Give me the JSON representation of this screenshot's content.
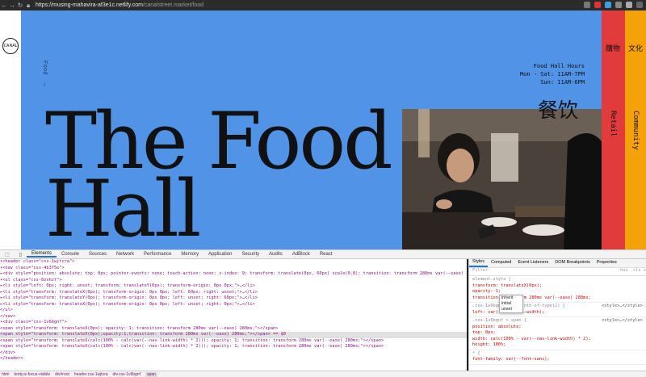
{
  "browser": {
    "url_host": "https://musing-mahavira-af3e1c.netlify.com",
    "url_path": "/canalstreet.market/food"
  },
  "site": {
    "logo_text": "CANAL",
    "food_nav": "Food",
    "hours_title": "Food Hall Hours",
    "hours_line1": "Mon - Sat: 11AM-7PM",
    "hours_line2": "Sun: 11AM-6PM",
    "chinese_title": "餐饮",
    "hero_line1": "The Food",
    "hero_line2": "Hall",
    "retail_ch": "購物",
    "retail": "Retail",
    "community_ch": "文化",
    "community": "Community",
    "colors": {
      "blue": "#5193e6",
      "red": "#e23b3b",
      "orange": "#f5a10a"
    }
  },
  "devtools": {
    "tabs": [
      "Elements",
      "Console",
      "Sources",
      "Network",
      "Performance",
      "Memory",
      "Application",
      "Security",
      "Audits",
      "AdBlock",
      "React"
    ],
    "elements_lines": [
      "▾<header class=\"css-1wjtcra\">",
      "  ▾<nav class=\"css-4b375e\">",
      "    ▸<div style=\"position: absolute; top: 0px; pointer-events: none; touch-action: none; z-index: 9; transform: translate(0px, 60px) scale(0.8); transition: transform 280ms var(--ease) 280ms;\">…</div>",
      "    ▾<ul class=\"css-8zvhzf\">",
      "      ▸<li style=\"left: 0px; right: unset; transform: translateY(0px); transform-origin: 0px 0px;\">…</li>",
      "      ▸<li style=\"transform: translateX(0px); transform-origin: 0px 0px; left: 60px; right: unset;\">…</li>",
      "      ▸<li style=\"transform: translateY(0px); transform-origin: 0px 0px; left: unset; right: 60px;\">…</li>",
      "      ▸<li style=\"transform: translateX(0px); transform-origin: 0px 0px; left: unset; right: 0px;\">…</li>",
      "     </ul>",
      "   </nav>",
      "  ▾<div class=\"css-1v6bgnf\">",
      "     <span style=\"transform: translateX(0px); opacity: 1; transition: transform 280ms var(--ease) 280ms;\"></span>",
      "     <span style=\"transform: translateX(0px);opacity:1;transition: transform 280ms var(--ease) 280ms;\"></span> == $0",
      "     <span style=\"transform: translateX(calc(100% - calc(var(--nav-link-width) * 2))); opacity: 1; transition: transform 280ms var(--ease) 280ms;\"></span>",
      "     <span style=\"transform: translateX(calc(100% - calc(var(--nav-link-width) * 2))); opacity: 1; transition: transform 280ms var(--ease) 280ms;\"></span>",
      "   </div>",
      "  </header>"
    ],
    "styles_tabs": [
      "Styles",
      "Computed",
      "Event Listeners",
      "DOM Breakpoints",
      "Properties"
    ],
    "filter_placeholder": "Filter",
    "filter_toggles": ":hov .cls +",
    "element_style_header": "element.style {",
    "element_style_props": [
      "transform: translateX(0px);",
      "opacity: 1;",
      "transition: transform 280ms var(--ease) 280ms;"
    ],
    "dropdown_options": [
      "inherit",
      "initial",
      "unset"
    ],
    "rule2_selector": ".css-1v6bgnf > span:nth-of-type(2) {",
    "rule2_prop": "left: var(--nav-link-width);",
    "rule2_src": "<style>…</style>",
    "rule3_selector": ".css-1v6bgnf > span {",
    "rule3_props": [
      "position: absolute;",
      "top: 0px;",
      "width: calc(100% - var(--nav-link-width) * 2);",
      "height: 100%;"
    ],
    "rule3_src": "<style>…</style>",
    "rule4_selector": "* {",
    "rule4_prop": "font-family: var(--font-sans);",
    "breadcrumbs": [
      "html",
      "body.is-focus-visible",
      "div#root",
      "header.css-1wjtcra",
      "div.css-1v6bgnf",
      "span"
    ]
  }
}
